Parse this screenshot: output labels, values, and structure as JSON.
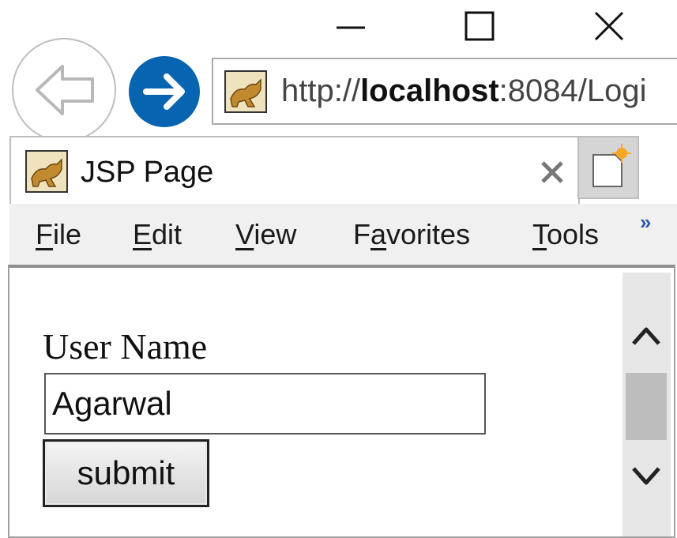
{
  "window": {
    "minimize_icon": "minimize-icon",
    "maximize_icon": "maximize-icon",
    "close_icon": "close-icon"
  },
  "navigation": {
    "back_icon": "back-arrow-icon",
    "forward_icon": "forward-arrow-icon",
    "accent_color": "#0764b0"
  },
  "address_bar": {
    "url_prefix": "http://",
    "url_host": "localhost",
    "url_rest": ":8084/Logi"
  },
  "tab": {
    "title": "JSP Page",
    "favicon": "tomcat-icon",
    "close_icon": "close-icon"
  },
  "new_tab": {
    "icon": "new-tab-icon"
  },
  "menu": {
    "items": [
      {
        "accel": "F",
        "rest": "ile"
      },
      {
        "accel": "E",
        "rest": "dit"
      },
      {
        "accel": "V",
        "rest": "iew"
      },
      {
        "pre": "F",
        "accel": "a",
        "rest": "vorites"
      },
      {
        "accel": "T",
        "rest": "ools"
      }
    ],
    "overflow": "»"
  },
  "form": {
    "label": "User Name",
    "username_value": "Agarwal",
    "submit_label": "submit"
  },
  "scrollbar": {
    "up_icon": "chevron-up-icon",
    "down_icon": "chevron-down-icon"
  }
}
